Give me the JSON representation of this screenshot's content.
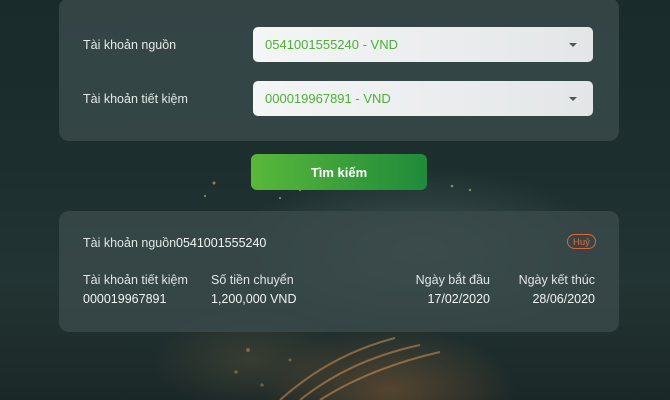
{
  "form": {
    "source_account_label": "Tài khoản nguồn",
    "source_account_value": "0541001555240 - VND",
    "savings_account_label": "Tài khoản tiết kiệm",
    "savings_account_value": "000019967891 - VND",
    "search_button_label": "Tìm kiếm"
  },
  "result": {
    "source_account_label": "Tài khoản nguồn",
    "source_account_value": "0541001555240",
    "cancel_badge": "Huỷ",
    "columns": {
      "savings_account": {
        "label": "Tài khoản tiết kiệm",
        "value": "000019967891"
      },
      "transfer_amount": {
        "label": "Số tiền chuyển",
        "value": "1,200,000 VND"
      },
      "start_date": {
        "label": "Ngày bắt đầu",
        "value": "17/02/2020"
      },
      "end_date": {
        "label": "Ngày kết thúc",
        "value": "28/06/2020"
      }
    }
  },
  "colors": {
    "accent_green": "#4caf36",
    "button_gradient_start": "#59b83a",
    "button_gradient_end": "#1f8a3a",
    "cancel_orange": "#e36a3c"
  }
}
